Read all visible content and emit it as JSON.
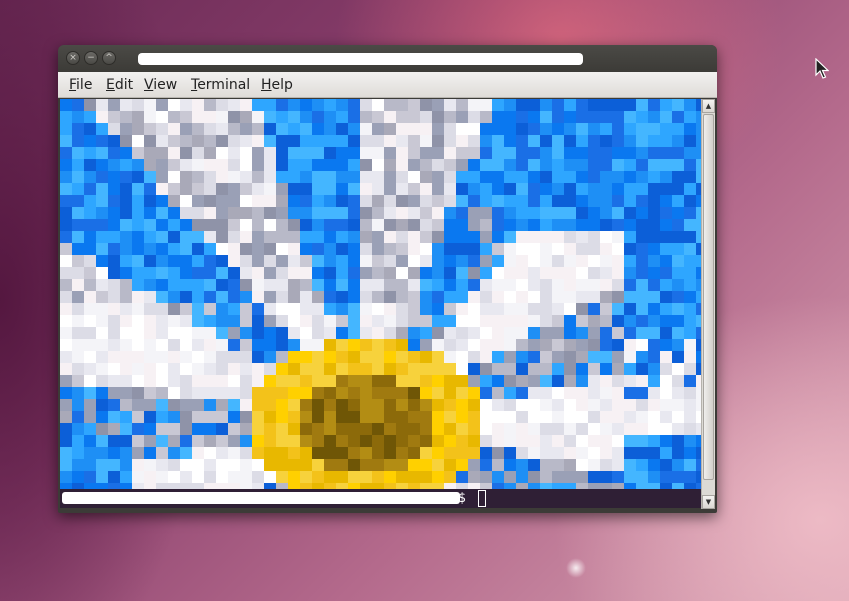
{
  "desktop": {
    "cursor_icon": "arrow-pointer-icon"
  },
  "window": {
    "title": "",
    "title_redacted": true,
    "buttons": {
      "close": "×",
      "minimize": "−",
      "maximize": "^"
    }
  },
  "menubar": {
    "items": [
      "File",
      "Edit",
      "View",
      "Terminal",
      "Help"
    ]
  },
  "terminal": {
    "background_image": "pixelated-daisy-flower",
    "prompt_text": "",
    "prompt_suffix": "$",
    "prompt_redacted": true
  },
  "scrollbar": {
    "up": "▲",
    "down": "▼"
  },
  "colors": {
    "titlebar": "#3c3b37",
    "menubar": "#f2f1f0",
    "prompt_bg": "#2f1f35",
    "sky_blue": "#1e8ff5",
    "petal_white": "#f4f4f8",
    "petal_gray": "#a9a9b8",
    "center_yellow": "#f3c21a",
    "center_dark": "#8c6a0a"
  }
}
